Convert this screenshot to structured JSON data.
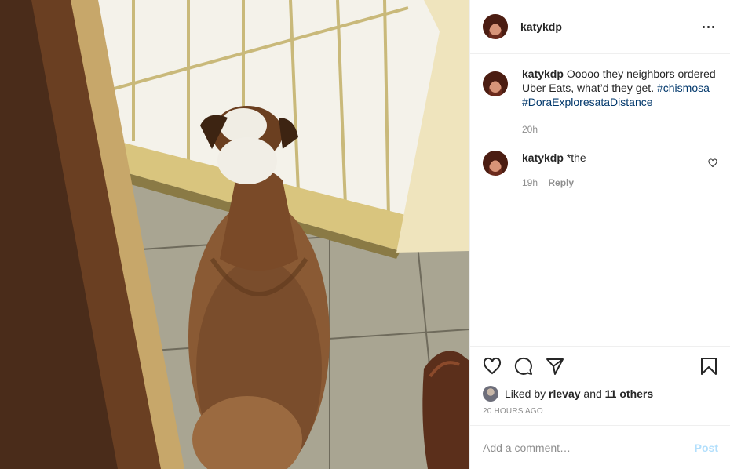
{
  "post": {
    "author": "katykdp",
    "photo": {
      "subject": "dog-looking-out-door-icon"
    }
  },
  "header": {
    "username": "katykdp",
    "more_icon": "more-horizontal-icon"
  },
  "comments": [
    {
      "user": "katykdp",
      "text": "Ooooo they neighbors ordered Uber Eats, what’d they get.",
      "hashtags": [
        "#chismosa",
        "#DoraExploresataDistance"
      ],
      "time": "20h"
    },
    {
      "user": "katykdp",
      "text": "*the",
      "time": "19h",
      "reply_label": "Reply",
      "like_icon": "heart-outline-icon"
    }
  ],
  "actions": {
    "like_icon": "heart-outline-icon",
    "comment_icon": "comment-bubble-icon",
    "share_icon": "paper-plane-icon",
    "save_icon": "bookmark-icon"
  },
  "likes": {
    "prefix": "Liked by",
    "user": "rlevay",
    "conjunction": "and",
    "others": "11 others"
  },
  "timestamp": "20 HOURS AGO",
  "add_comment": {
    "placeholder": "Add a comment…",
    "post_label": "Post"
  },
  "colors": {
    "hashtag": "#00376b",
    "muted": "#8e8e8e",
    "post_disabled": "#b2dffc",
    "text": "#262626",
    "divider": "#efefef"
  }
}
